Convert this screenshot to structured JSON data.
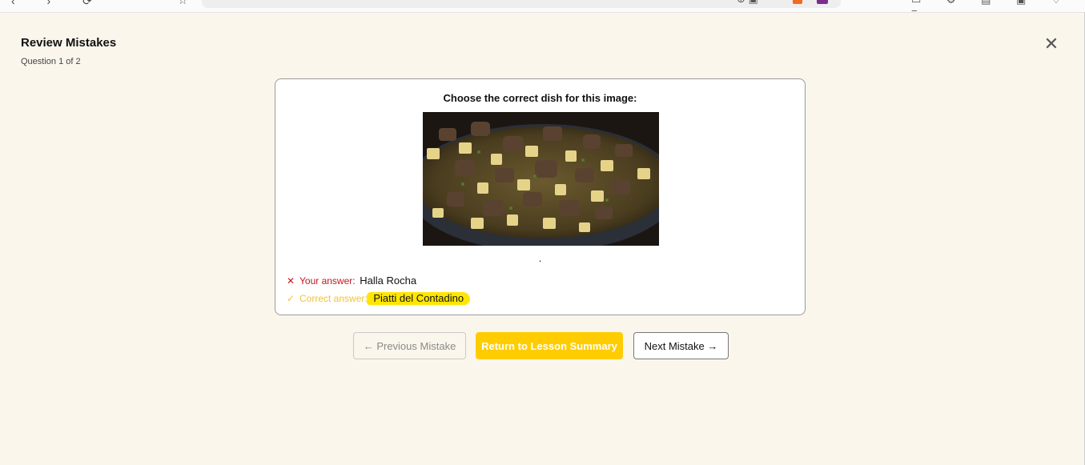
{
  "header": {
    "title": "Review Mistakes",
    "progress": "Question 1 of 2"
  },
  "question": {
    "prompt": "Choose the correct dish for this image:",
    "caption": ".",
    "your_answer_label": "Your answer:",
    "your_answer_value": "Halla Rocha",
    "correct_answer_label": "Correct answer:",
    "correct_answer_value": "Piatti del Contadino"
  },
  "buttons": {
    "previous": "← Previous Mistake",
    "return": "Return to Lesson Summary",
    "next": "Next Mistake →"
  },
  "icons": {
    "close": "close-icon",
    "wrong": "x-icon",
    "correct": "check-icon"
  },
  "colors": {
    "page_bg": "#faf6ec",
    "accent": "#ffcc00",
    "wrong": "#c0191f",
    "correct": "#f1c232",
    "highlight": "#ffe600"
  }
}
